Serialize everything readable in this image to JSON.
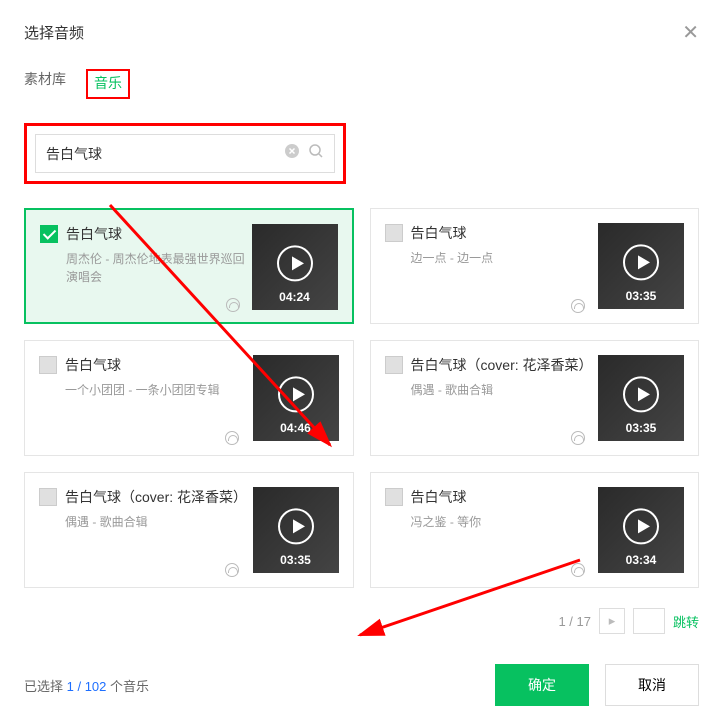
{
  "header": {
    "title": "选择音频"
  },
  "tabs": {
    "library": "素材库",
    "music": "音乐"
  },
  "search": {
    "value": "告白气球"
  },
  "cards": [
    {
      "title": "告白气球",
      "subtitle": "周杰伦 - 周杰伦地表最强世界巡回演唱会",
      "duration": "04:24",
      "selected": true
    },
    {
      "title": "告白气球",
      "subtitle": "边一点 - 边一点",
      "duration": "03:35",
      "selected": false
    },
    {
      "title": "告白气球",
      "subtitle": "一个小团团 - 一条小团团专辑",
      "duration": "04:46",
      "selected": false
    },
    {
      "title": "告白气球（cover: 花泽香菜）",
      "subtitle": "偶遇 - 歌曲合辑",
      "duration": "03:35",
      "selected": false
    },
    {
      "title": "告白气球（cover: 花泽香菜）",
      "subtitle": "偶遇 - 歌曲合辑",
      "duration": "03:35",
      "selected": false
    },
    {
      "title": "告白气球",
      "subtitle": "冯之鉴 - 等你",
      "duration": "03:34",
      "selected": false
    }
  ],
  "pagination": {
    "current": "1 / 17",
    "jump": "跳转"
  },
  "footer": {
    "selected_prefix": "已选择 ",
    "selected_count": "1 / 102",
    "selected_suffix": " 个音乐",
    "confirm": "确定",
    "cancel": "取消"
  }
}
